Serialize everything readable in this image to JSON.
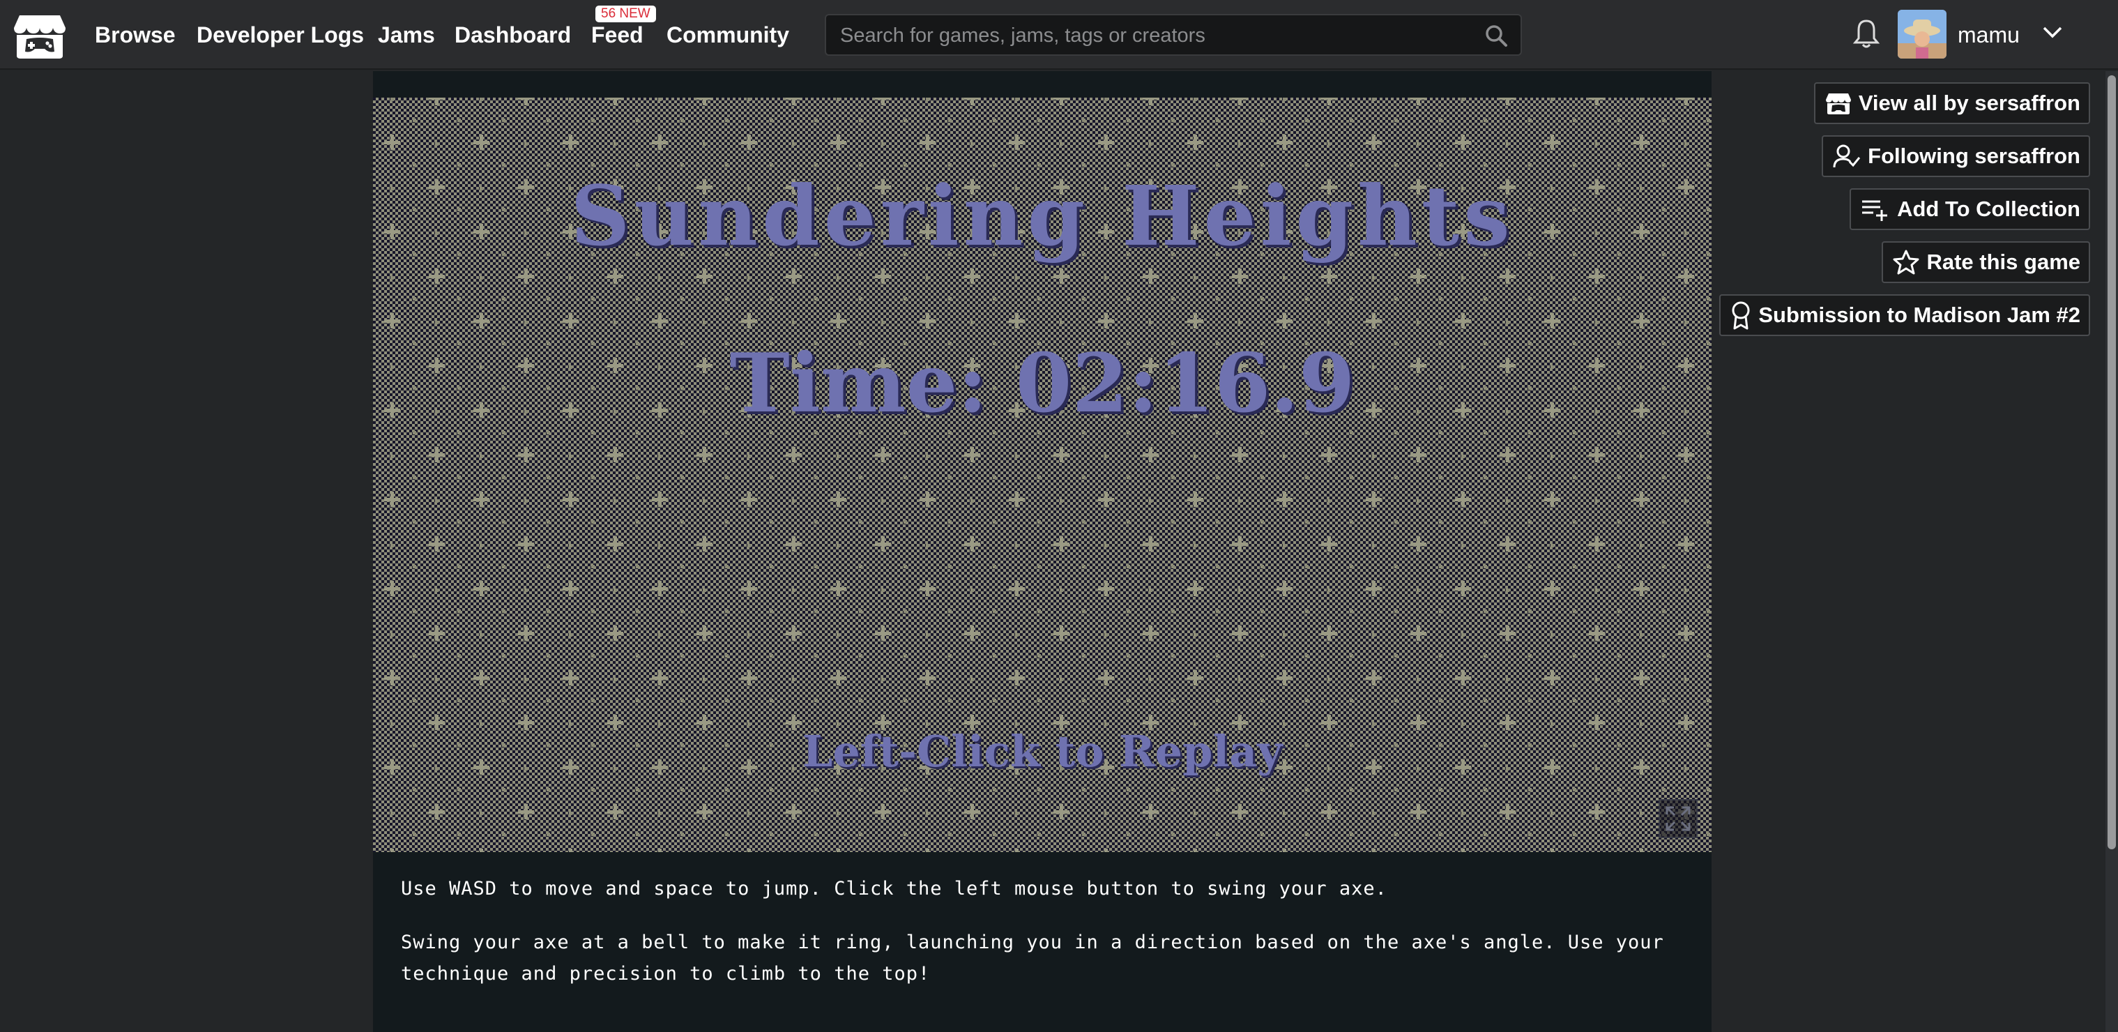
{
  "nav": {
    "browse": "Browse",
    "devlogs": "Developer Logs",
    "jams": "Jams",
    "dashboard": "Dashboard",
    "feed": "Feed",
    "feed_badge": "56 NEW",
    "community": "Community"
  },
  "search": {
    "placeholder": "Search for games, jams, tags or creators"
  },
  "user": {
    "name": "mamu"
  },
  "game": {
    "title": "Sundering Heights",
    "time": "Time: 02:16.9",
    "replay": "Left-Click to Replay"
  },
  "description": {
    "p1": "Use WASD to move and space to jump. Click the left mouse button to swing your axe.",
    "p2": "Swing your axe at a bell to make it ring, launching you in a direction based on the axe's angle. Use your technique and precision to climb to the top!"
  },
  "sidebar": {
    "view_all": "View all by sersaffron",
    "following": "Following sersaffron",
    "add_collection": "Add To Collection",
    "rate": "Rate this game",
    "submission": "Submission to Madison Jam #2"
  },
  "colors": {
    "accent": "#da2c38",
    "game_text": "#6f72b0",
    "game_bg": "#121121"
  }
}
